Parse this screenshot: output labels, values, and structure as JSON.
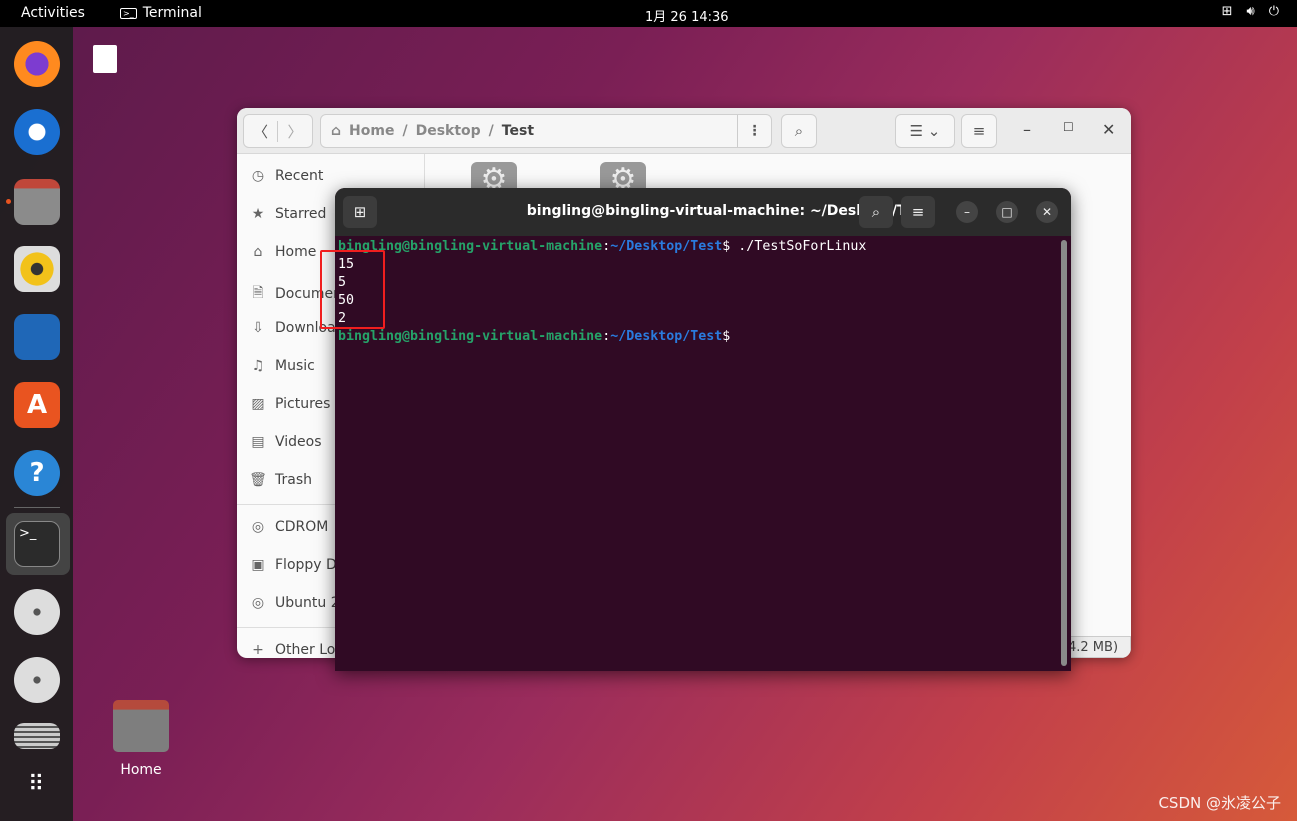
{
  "topbar": {
    "activities": "Activities",
    "app": "Terminal",
    "clock": "1月 26  14:36",
    "tray": [
      "network-icon",
      "volume-icon",
      "power-icon"
    ]
  },
  "dock": {
    "apps": [
      "Firefox",
      "Thunderbird",
      "Files",
      "Rhythmbox",
      "LibreOffice Writer",
      "Ubuntu Software",
      "Help",
      "Terminal",
      "CD Drive",
      "CD Drive",
      "Floppy",
      "Show Applications"
    ]
  },
  "desktop": {
    "home_label": "Home"
  },
  "files": {
    "breadcrumb": [
      "Home",
      "Desktop",
      "Test"
    ],
    "sidebar": [
      "Recent",
      "Starred",
      "Home",
      "Documents",
      "Downloads",
      "Music",
      "Pictures",
      "Videos",
      "Trash"
    ],
    "devices": [
      "CDROM",
      "Floppy Disk",
      "Ubuntu 2"
    ],
    "other": "Other Locations",
    "status": "4.2 MB)"
  },
  "terminal": {
    "title": "bingling@bingling-virtual-machine: ~/Desktop/Test",
    "user": "bingling@bingling-virtual-machine",
    "path": "~/Desktop/Test",
    "command": " ./TestSoForLinux",
    "output": [
      "15",
      "5",
      "50",
      "2"
    ]
  },
  "watermark": "CSDN @氷凌公子",
  "colors": {
    "terminal_bg": "#300a24",
    "prompt_user": "#26a269",
    "prompt_path": "#2a7bde",
    "highlight_box": "#f01e1e",
    "accent": "#e95420"
  }
}
